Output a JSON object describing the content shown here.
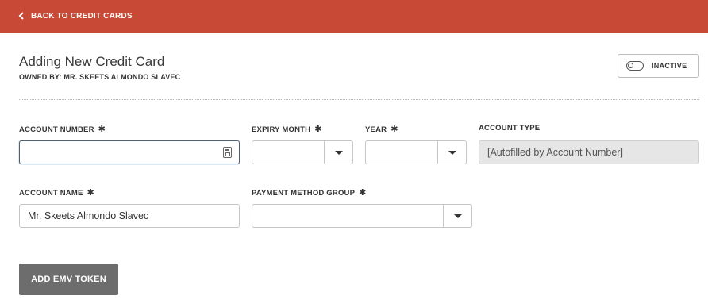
{
  "header": {
    "back_label": "BACK TO CREDIT CARDS",
    "back_icon": "chevron-left-icon",
    "bar_color": "#c84a36"
  },
  "page": {
    "title": "Adding New Credit Card",
    "owned_by": "OWNED BY: MR. SKEETS ALMONDO SLAVEC"
  },
  "status_toggle": {
    "label": "INACTIVE",
    "icon": "toggle-off-icon",
    "state": "off"
  },
  "form": {
    "required_marker": "✱",
    "account_number": {
      "label": "ACCOUNT NUMBER",
      "value": "",
      "icon": "card-icon"
    },
    "expiry_month": {
      "label": "EXPIRY MONTH",
      "value": ""
    },
    "year": {
      "label": "YEAR",
      "value": ""
    },
    "account_type": {
      "label": "ACCOUNT TYPE",
      "value": "[Autofilled by Account Number]"
    },
    "account_name": {
      "label": "ACCOUNT NAME",
      "value": "Mr. Skeets Almondo Slavec"
    },
    "payment_method_group": {
      "label": "PAYMENT METHOD GROUP",
      "value": ""
    }
  },
  "actions": {
    "add_emv_label": "ADD EMV TOKEN",
    "button_color": "#6d6d6d"
  }
}
